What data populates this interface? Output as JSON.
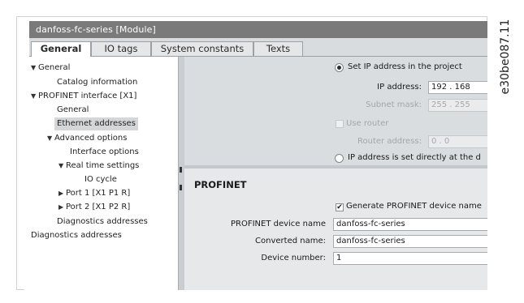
{
  "window": {
    "title": "danfoss-fc-series [Module]"
  },
  "tabs": [
    {
      "label": "General",
      "active": true
    },
    {
      "label": "IO tags",
      "active": false
    },
    {
      "label": "System constants",
      "active": false
    },
    {
      "label": "Texts",
      "active": false
    }
  ],
  "tree": [
    {
      "label": "General",
      "expanded": true
    },
    {
      "label": "Catalog information"
    },
    {
      "label": "PROFINET interface [X1]",
      "expanded": true
    },
    {
      "label": "General"
    },
    {
      "label": "Ethernet addresses",
      "selected": true
    },
    {
      "label": "Advanced options",
      "expanded": true
    },
    {
      "label": "Interface options"
    },
    {
      "label": "Real time settings",
      "expanded": true
    },
    {
      "label": "IO cycle"
    },
    {
      "label": "Port 1 [X1 P1 R]",
      "expanded": false
    },
    {
      "label": "Port 2 [X1 P2 R]",
      "expanded": false
    },
    {
      "label": "Diagnostics addresses"
    },
    {
      "label": "Diagnostics addresses"
    }
  ],
  "ip": {
    "set_in_project_label": "Set IP address in the project",
    "ip_address_label": "IP address:",
    "ip_address_value": "192 . 168",
    "subnet_mask_label": "Subnet mask:",
    "subnet_mask_value": "255 . 255",
    "use_router_label": "Use router",
    "router_address_label": "Router address:",
    "router_address_value": "0   . 0",
    "set_directly_label": "IP address is set directly at the d"
  },
  "profinet": {
    "title": "PROFINET",
    "generate_label": "Generate PROFINET device name",
    "generate_checked": true,
    "device_name_label": "PROFINET device name",
    "device_name_value": "danfoss-fc-series",
    "converted_name_label": "Converted name:",
    "converted_name_value": "danfoss-fc-series",
    "device_number_label": "Device number:",
    "device_number_value": "1"
  },
  "side_label": "e30be087.11"
}
